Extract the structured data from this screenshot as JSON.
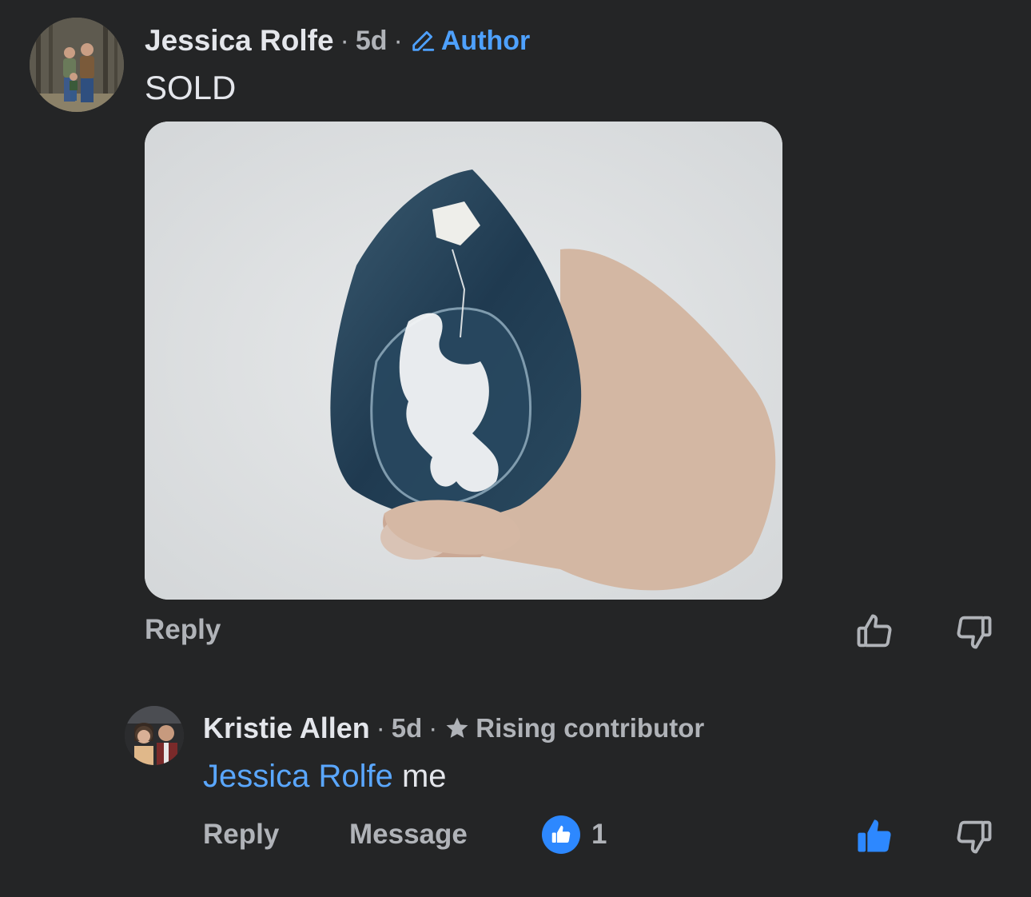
{
  "comments": [
    {
      "author": "Jessica Rolfe",
      "separator": "·",
      "time": "5d",
      "badge": "Author",
      "text": "SOLD",
      "actions": {
        "reply": "Reply"
      }
    },
    {
      "author": "Kristie Allen",
      "separator": "·",
      "time": "5d",
      "badge": "Rising contributor",
      "mention": "Jessica Rolfe",
      "text": " me",
      "actions": {
        "reply": "Reply",
        "message": "Message"
      },
      "reaction_count": "1"
    }
  ],
  "colors": {
    "background": "#242526",
    "text": "#e4e6eb",
    "muted": "#b0b3b8",
    "accent": "#2d88ff",
    "mention": "#5aa7ff"
  },
  "icons": [
    "pencil-icon",
    "star-icon",
    "like-icon",
    "dislike-icon",
    "like-filled-icon",
    "reaction-like-icon"
  ]
}
